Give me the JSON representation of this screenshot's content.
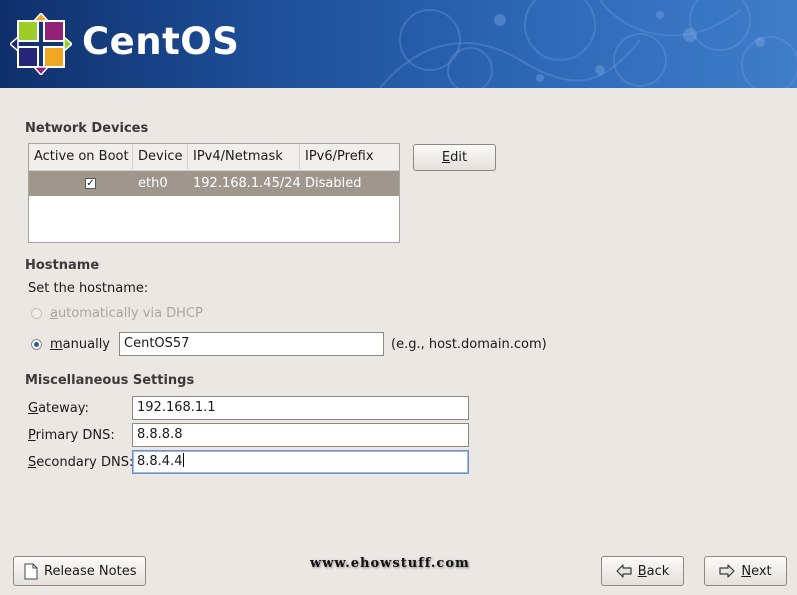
{
  "banner": {
    "brand": "CentOS"
  },
  "network_devices": {
    "title": "Network Devices",
    "columns": [
      "Active on Boot",
      "Device",
      "IPv4/Netmask",
      "IPv6/Prefix"
    ],
    "rows": [
      {
        "active_on_boot": true,
        "device": "eth0",
        "ipv4": "192.168.1.45/24",
        "ipv6": "Disabled"
      }
    ],
    "edit_button": {
      "mnemonic": "E",
      "rest": "dit"
    }
  },
  "hostname": {
    "title": "Hostname",
    "prompt": "Set the hostname:",
    "auto_option": {
      "mnemonic": "a",
      "rest": "utomatically via DHCP",
      "enabled": false,
      "selected": false
    },
    "manual_option": {
      "mnemonic": "m",
      "rest": "anually",
      "selected": true
    },
    "manual_value": "CentOS57",
    "example": "(e.g., host.domain.com)"
  },
  "misc": {
    "title": "Miscellaneous Settings",
    "gateway": {
      "mnemonic": "G",
      "rest": "ateway:",
      "value": "192.168.1.1"
    },
    "primary_dns": {
      "mnemonic": "P",
      "rest": "rimary DNS:",
      "value": "8.8.8.8"
    },
    "secondary_dns": {
      "mnemonic": "S",
      "rest": "econdary DNS:",
      "value": "8.8.4.4"
    }
  },
  "footer": {
    "release_notes": "Release Notes",
    "watermark": "www.ehowstuff.com",
    "back": {
      "mnemonic": "B",
      "rest": "ack"
    },
    "next": {
      "mnemonic": "N",
      "rest": "ext"
    }
  }
}
